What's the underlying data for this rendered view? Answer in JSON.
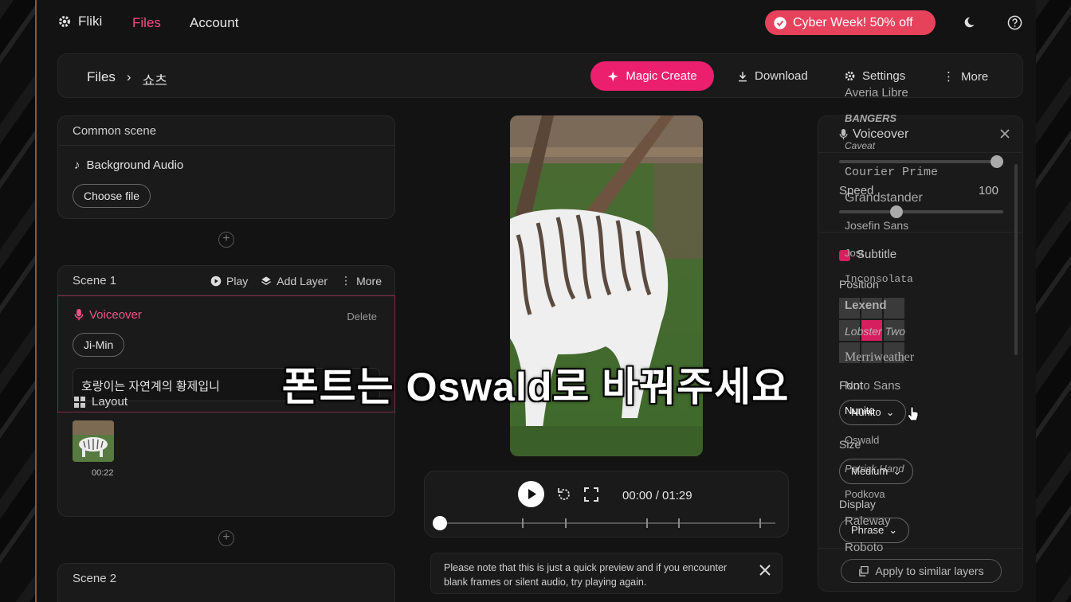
{
  "nav": {
    "brand": "Fliki",
    "files": "Files",
    "account": "Account",
    "promo": "Cyber Week! 50% off"
  },
  "toolbar": {
    "crumb_root": "Files",
    "crumb_sep": "›",
    "crumb_current": "쇼츠",
    "magic_create": "Magic Create",
    "download": "Download",
    "settings": "Settings",
    "more": "More"
  },
  "common_scene": {
    "title": "Common scene",
    "bg_audio": "Background Audio",
    "choose_file": "Choose file"
  },
  "scene1": {
    "title": "Scene 1",
    "play": "Play",
    "add_layer": "Add Layer",
    "more": "More",
    "voiceover": "Voiceover",
    "delete": "Delete",
    "voice": "Ji-Min",
    "text": "호랑이는 자연계의 황제입니",
    "layout": "Layout",
    "thumb_time": "00:22"
  },
  "scene2": {
    "title": "Scene 2"
  },
  "player": {
    "time": "00:00 / 01:29"
  },
  "notice": {
    "text": "Please note that this is just a quick preview and if you encounter blank frames or silent audio, try playing again."
  },
  "right_panel": {
    "title": "Voiceover",
    "speed_label": "Speed",
    "speed_value": "100",
    "subtitle": "Subtitle",
    "position": "Position",
    "font_label": "Font",
    "font_value": "Nunito",
    "size_label": "Size",
    "size_value": "Medium",
    "display_label": "Display",
    "display_value": "Phrase",
    "apply": "Apply to similar layers"
  },
  "font_dropdown": [
    "Averia Libre",
    "BANGERS",
    "Caveat",
    "Courier Prime",
    "Grandstander",
    "Josefin Sans",
    "Jost",
    "Inconsolata",
    "Lexend",
    "Lobster Two",
    "Merriweather",
    "Noto Sans",
    "Nunito",
    "Oswald",
    "Patrick Hand",
    "Podkova",
    "Raleway",
    "Roboto"
  ],
  "caption": "폰트는 Oswald로 바꿔주세요",
  "colors": {
    "accent": "#ec1f6f",
    "promo": "#e7425c"
  }
}
